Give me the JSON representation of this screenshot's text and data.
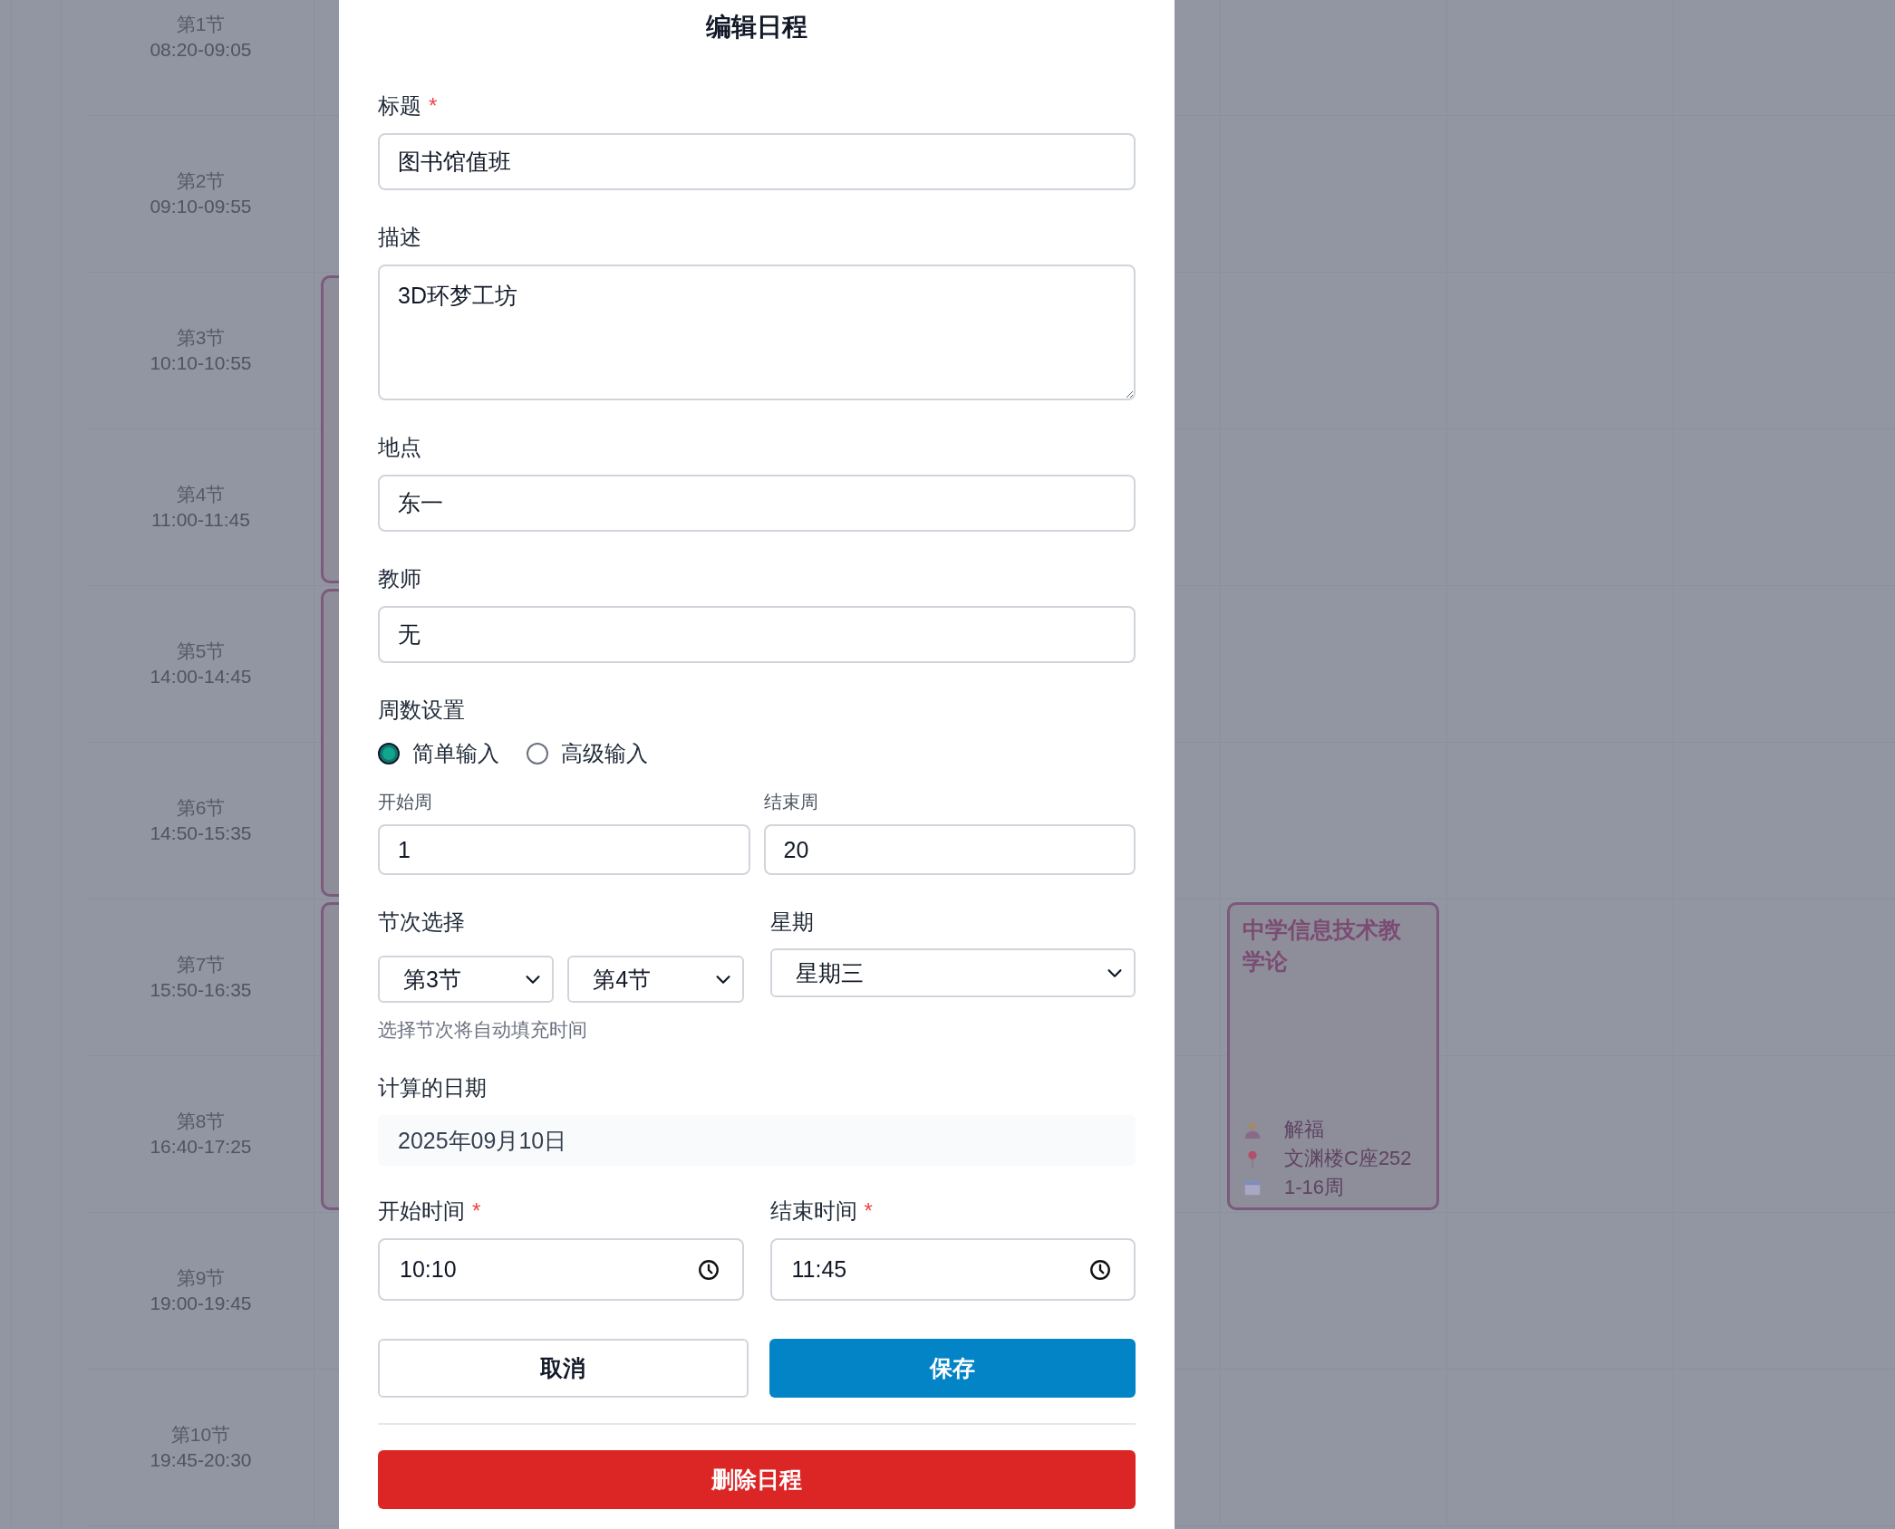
{
  "timetable": {
    "periods": [
      {
        "label": "第1节",
        "time": "08:20-09:05"
      },
      {
        "label": "第2节",
        "time": "09:10-09:55"
      },
      {
        "label": "第3节",
        "time": "10:10-10:55"
      },
      {
        "label": "第4节",
        "time": "11:00-11:45"
      },
      {
        "label": "第5节",
        "time": "14:00-14:45"
      },
      {
        "label": "第6节",
        "time": "14:50-15:35"
      },
      {
        "label": "第7节",
        "time": "15:50-16:35"
      },
      {
        "label": "第8节",
        "time": "16:40-17:25"
      },
      {
        "label": "第9节",
        "time": "19:00-19:45"
      },
      {
        "label": "第10节",
        "time": "19:45-20:30"
      }
    ],
    "hidden_cards": [
      {
        "kind": "course"
      },
      {
        "kind": "course"
      },
      {
        "kind": "course"
      }
    ],
    "course_card": {
      "title": "中学信息技术教学论",
      "teacher": "解福",
      "location": "文渊楼C座252",
      "weeks": "1-16周"
    }
  },
  "dialog": {
    "title": "编辑日程",
    "fields": [
      {
        "kind": "text",
        "label": "标题",
        "required_mark": "*",
        "value": "图书馆值班"
      },
      {
        "kind": "textarea",
        "label": "描述",
        "value": "3D环梦工坊"
      },
      {
        "kind": "text",
        "label": "地点",
        "value": "东一"
      },
      {
        "kind": "text",
        "label": "教师",
        "value": "无"
      }
    ],
    "week_settings": {
      "label": "周数设置",
      "modes": [
        {
          "label": "简单输入",
          "selected": true
        },
        {
          "label": "高级输入",
          "selected": false
        }
      ],
      "start": {
        "label": "开始周",
        "value": "1"
      },
      "end": {
        "label": "结束周",
        "value": "20"
      }
    },
    "period_select": {
      "label": "节次选择",
      "from": "第3节",
      "to": "第4节",
      "hint": "选择节次将自动填充时间"
    },
    "weekday": {
      "label": "星期",
      "value": "星期三"
    },
    "computed_date": {
      "label": "计算的日期",
      "value": "2025年09月10日"
    },
    "times": [
      {
        "label": "开始时间",
        "required_mark": "*",
        "value": "10:10"
      },
      {
        "label": "结束时间",
        "required_mark": "*",
        "value": "11:45"
      }
    ],
    "buttons": [
      {
        "kind": "secondary",
        "label": "取消"
      },
      {
        "kind": "primary",
        "label": "保存"
      }
    ],
    "delete_button": {
      "label": "删除日程"
    }
  }
}
